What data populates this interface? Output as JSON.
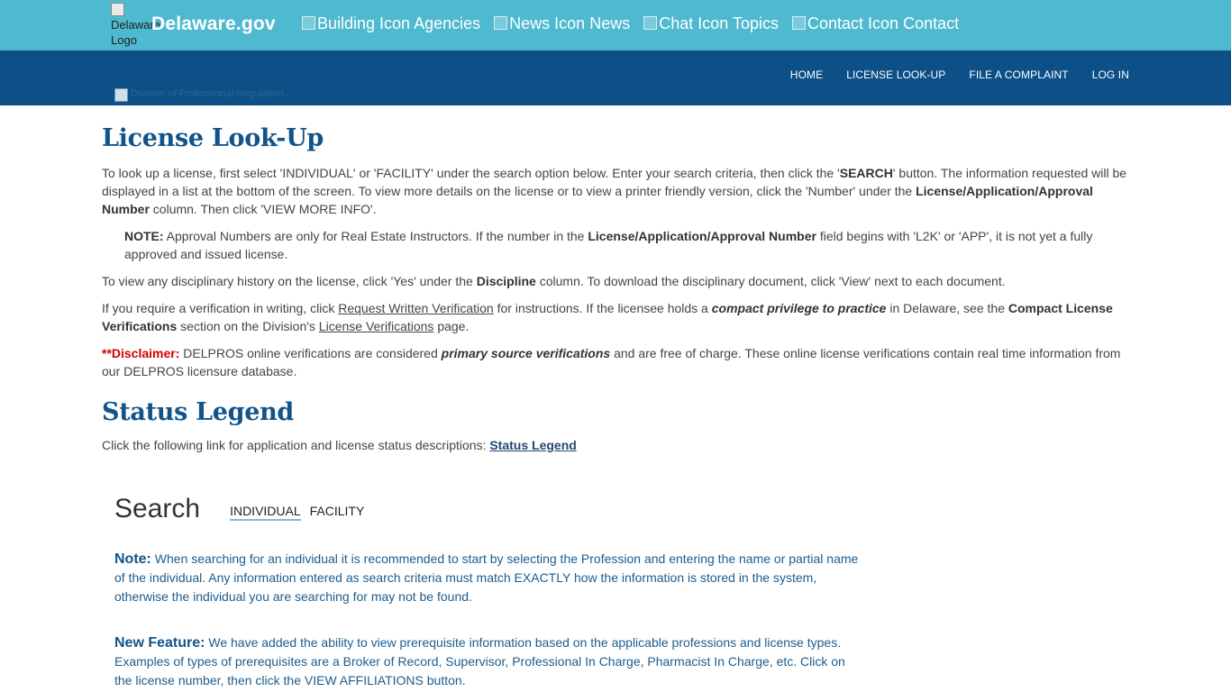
{
  "topbar": {
    "logo_alt": "Delaware Logo",
    "brand": "Delaware.gov",
    "links": [
      {
        "label": "Agencies",
        "alt": "Building Icon"
      },
      {
        "label": "News",
        "alt": "News Icon"
      },
      {
        "label": "Topics",
        "alt": "Chat Icon"
      },
      {
        "label": "Contact",
        "alt": "Contact Icon"
      }
    ]
  },
  "navbar": {
    "division_logo_alt": "Division of Professional Regulation",
    "items": [
      "HOME",
      "LICENSE LOOK-UP",
      "FILE A COMPLAINT",
      "LOG IN"
    ]
  },
  "main": {
    "title": "License Look-Up",
    "intro": {
      "a": "To look up a license, first select 'INDIVIDUAL' or 'FACILITY' under the search option below. Enter your search criteria, then click the '",
      "b": "SEARCH",
      "c": "' button. The information requested will be displayed in a list at the bottom of the screen. To view more details on the license or to view a printer friendly version, click the 'Number' under the ",
      "d": "License/Application/Approval Number",
      "e": " column. Then click 'VIEW MORE INFO'."
    },
    "note": {
      "label": "NOTE:",
      "a": " Approval Numbers are only for Real Estate Instructors. If the number in the ",
      "b": "License/Application/Approval Number",
      "c": " field begins with 'L2K' or 'APP', it is not yet a fully approved and issued license."
    },
    "discipline": {
      "a": "To view any disciplinary history on the license, click 'Yes' under the ",
      "b": "Discipline",
      "c": " column. To download the disciplinary document, click 'View' next to each document."
    },
    "verification": {
      "a": "If you require a verification in writing, click ",
      "link1": "Request Written Verification",
      "b": " for instructions. If the licensee holds a ",
      "c": "compact privilege to practice",
      "d": " in Delaware, see the ",
      "e": "Compact License Verifications",
      "f": " section on the Division's ",
      "link2": "License Verifications",
      "g": " page."
    },
    "disclaimer": {
      "label": "**Disclaimer:",
      "a": " DELPROS online verifications are considered ",
      "b": "primary source verifications",
      "c": " and are free of charge. These online license verifications contain real time information from our DELPROS licensure database."
    },
    "legend_title": "Status Legend",
    "legend_text": "Click the following link for application and license status descriptions: ",
    "legend_link": "Status Legend"
  },
  "search": {
    "title": "Search",
    "tabs": [
      "INDIVIDUAL",
      "FACILITY"
    ],
    "note_label": "Note:",
    "note_text": " When searching for an individual it is recommended to start by selecting the Profession and entering the name or partial name of the individual. Any information entered as search criteria must match EXACTLY how the information is stored in the system, otherwise the individual you are searching for may not be found.",
    "feature_label": "New Feature:",
    "feature_text": " We have added the ability to view prerequisite information based on the applicable professions and license types. Examples of types of prerequisites are a Broker of Record, Supervisor, Professional In Charge, Pharmacist In Charge, etc. Click on the license number, then click the VIEW AFFILIATIONS button."
  },
  "colors": {
    "topbar": "#4eb9cf",
    "navbar": "#0d4f87",
    "heading": "#12548a",
    "disclaimer": "#d40000"
  }
}
